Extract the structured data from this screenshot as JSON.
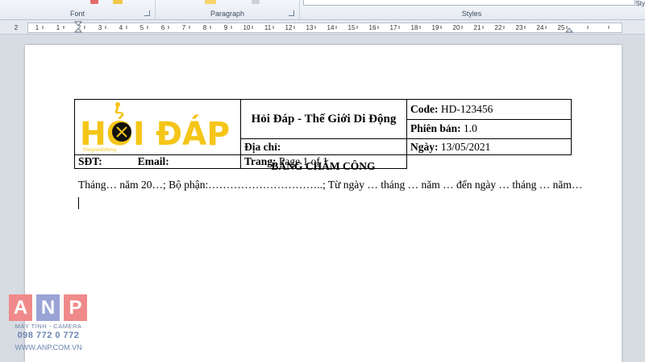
{
  "ribbon": {
    "font_group_label": "Font",
    "paragraph_group_label": "Paragraph",
    "styles_group_label": "Styles",
    "styles_partial_label": "Sty"
  },
  "ruler": {
    "numbers": [
      "2",
      "1",
      "1",
      "2",
      "3",
      "4",
      "5",
      "6",
      "7",
      "8",
      "9",
      "10",
      "11",
      "12",
      "13",
      "14",
      "15",
      "16",
      "17",
      "18",
      "19",
      "20",
      "21",
      "22",
      "23",
      "24",
      "25"
    ]
  },
  "document": {
    "logo": {
      "text": "HỎI ĐÁP",
      "tagline": "thegioididong",
      "color": "#f5c518"
    },
    "header_table": {
      "title": "Hỏi Đáp - Thế Giới Di Động",
      "code_label": "Code:",
      "code_value": " HD-123456",
      "version_label": "Phiên bản:",
      "version_value": " 1.0",
      "address_label": "Địa chỉ:",
      "date_label": "Ngày:",
      "date_value": " 13/05/2021",
      "phone_label": "SĐT:",
      "email_label": "Email:",
      "page_label": "Trang:",
      "page_value": " Page 1 of 1"
    },
    "title": "BẢNG CHẤM CÔNG",
    "line1": "Tháng… năm 20…; Bộ phận:…………………………..; Từ ngày … tháng … năm … đến ngày … tháng … năm…"
  },
  "watermark": {
    "letters": [
      "A",
      "N",
      "P"
    ],
    "tile_colors": [
      "#f08a8a",
      "#9aa3d6",
      "#f08a8a"
    ],
    "subtitle": "MÁY TÍNH - CAMERA",
    "phone": "098 772 0 772",
    "url": "WWW.ANP.COM.VN"
  }
}
